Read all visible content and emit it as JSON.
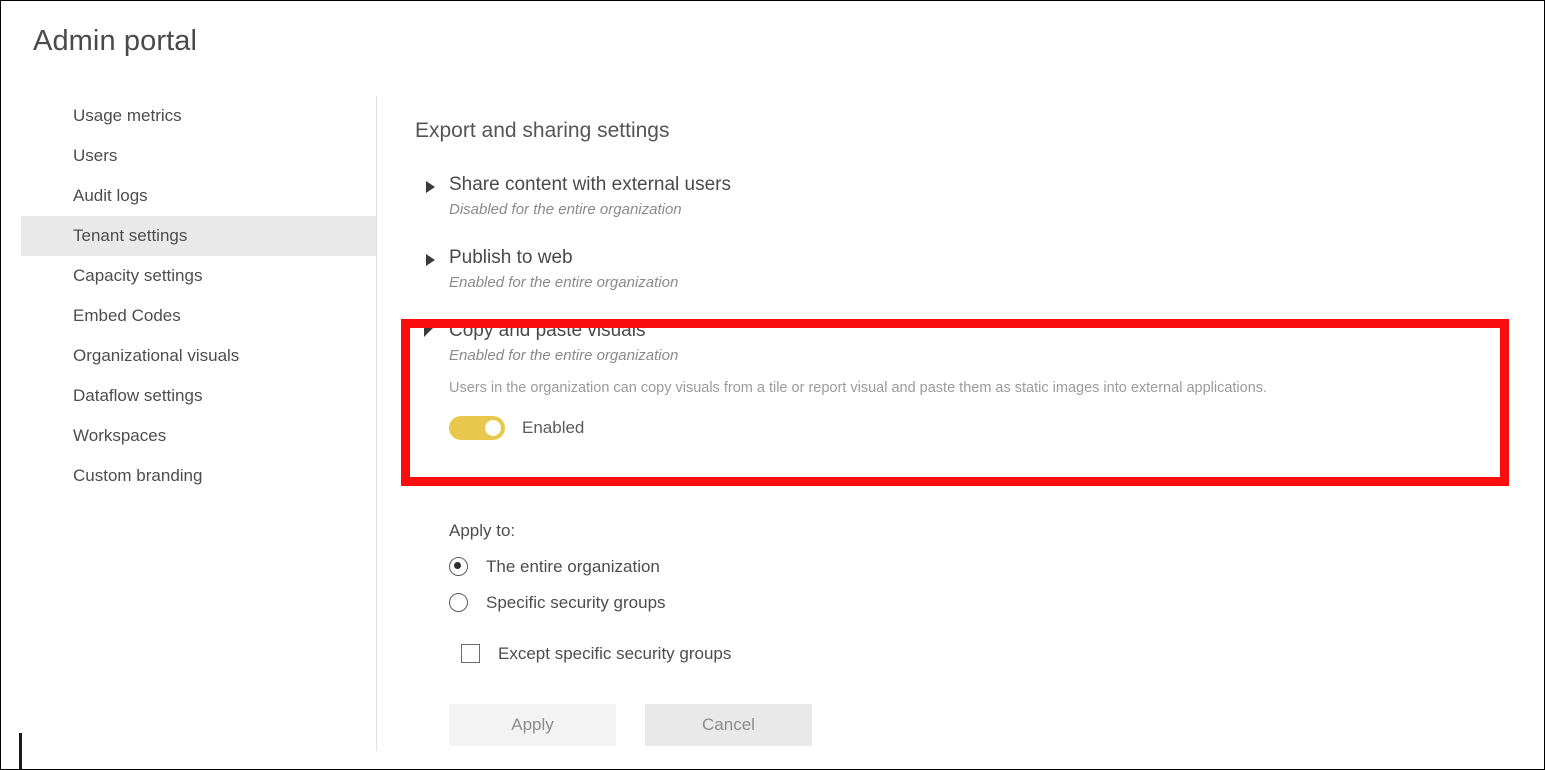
{
  "page": {
    "title": "Admin portal"
  },
  "sidebar": {
    "items": [
      {
        "label": "Usage metrics",
        "selected": false
      },
      {
        "label": "Users",
        "selected": false
      },
      {
        "label": "Audit logs",
        "selected": false
      },
      {
        "label": "Tenant settings",
        "selected": true
      },
      {
        "label": "Capacity settings",
        "selected": false
      },
      {
        "label": "Embed Codes",
        "selected": false
      },
      {
        "label": "Organizational visuals",
        "selected": false
      },
      {
        "label": "Dataflow settings",
        "selected": false
      },
      {
        "label": "Workspaces",
        "selected": false
      },
      {
        "label": "Custom branding",
        "selected": false
      }
    ]
  },
  "main": {
    "heading": "Export and sharing settings",
    "settings": [
      {
        "title": "Share content with external users",
        "status": "Disabled for the entire organization",
        "expanded": false,
        "marker": "chevron-right-icon"
      },
      {
        "title": "Publish to web",
        "status": "Enabled for the entire organization",
        "expanded": false,
        "marker": "chevron-right-icon"
      },
      {
        "title": "Copy and paste visuals",
        "status": "Enabled for the entire organization",
        "expanded": true,
        "marker": "chevron-down-icon",
        "description": "Users in the organization can copy visuals from a tile or report visual and paste them as static images into external applications.",
        "toggle": {
          "label": "Enabled",
          "on": true,
          "color": "#e8c84c"
        }
      }
    ],
    "apply_to": {
      "label": "Apply to:",
      "options": [
        {
          "label": "The entire organization",
          "selected": true
        },
        {
          "label": "Specific security groups",
          "selected": false
        }
      ],
      "checkbox": {
        "label": "Except specific security groups",
        "checked": false
      }
    },
    "buttons": {
      "apply": "Apply",
      "cancel": "Cancel"
    }
  },
  "annotations": {
    "highlight_color": "#fc0d0d"
  }
}
